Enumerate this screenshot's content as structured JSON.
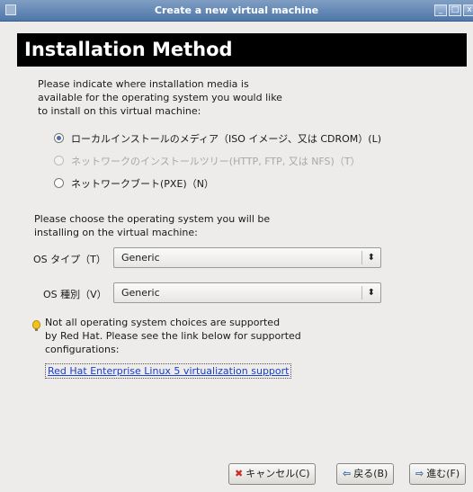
{
  "window": {
    "title": "Create a new virtual machine"
  },
  "header": {
    "title": "Installation Method"
  },
  "intro": "Please indicate where installation media is\navailable for the operating system you would like\nto install on this virtual machine:",
  "methods": [
    {
      "label": "ローカルインストールのメディア（ISO イメージ、又は CDROM）(L)",
      "checked": true,
      "enabled": true
    },
    {
      "label": "ネットワークのインストールツリー(HTTP, FTP, 又は NFS)（T）",
      "checked": false,
      "enabled": false
    },
    {
      "label": "ネットワークブート(PXE)（N）",
      "checked": false,
      "enabled": true
    }
  ],
  "os_prompt": "Please choose the operating system you will be\ninstalling on the virtual machine:",
  "os_type": {
    "label": "OS タイプ（T）",
    "value": "Generic"
  },
  "os_variant": {
    "label": "OS 種別（V）",
    "value": "Generic"
  },
  "note": "Not all operating system choices are supported\nby Red Hat. Please see the link below for supported\nconfigurations:",
  "link": "Red Hat Enterprise Linux 5 virtualization support",
  "buttons": {
    "cancel": "キャンセル(C)",
    "back": "戻る(B)",
    "forward": "進む(F)"
  }
}
